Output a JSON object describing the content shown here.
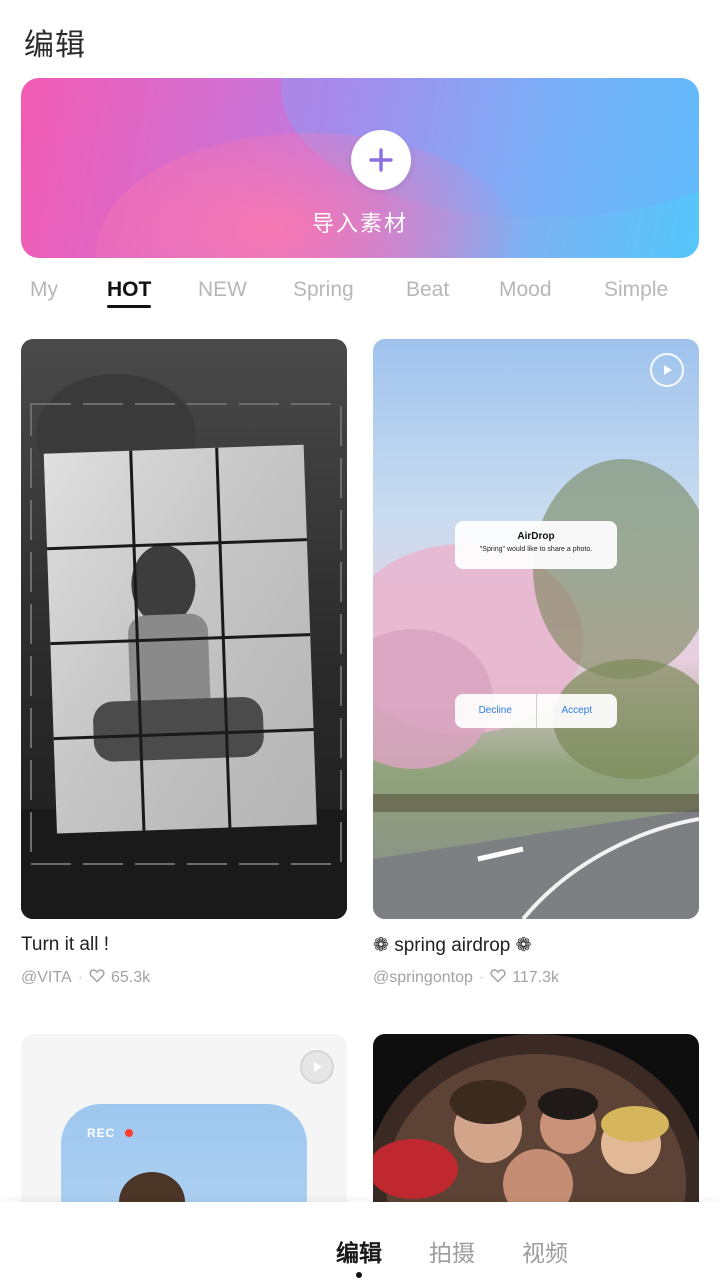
{
  "header": {
    "title": "编辑"
  },
  "banner": {
    "import_label": "导入素材"
  },
  "tabs": [
    "My",
    "HOT",
    "NEW",
    "Spring",
    "Beat",
    "Mood",
    "Simple"
  ],
  "active_tab": "HOT",
  "cards": [
    {
      "title": "Turn it all !",
      "author": "@VITA",
      "likes": "65.3k"
    },
    {
      "title": "❁ spring airdrop ❁",
      "author": "@springontop",
      "likes": "117.3k",
      "dialog": {
        "title": "AirDrop",
        "message": "\"Spring\" would like to share a photo.",
        "decline": "Decline",
        "accept": "Accept"
      }
    },
    {
      "rec_label": "REC"
    },
    {}
  ],
  "bottom_nav": [
    "编辑",
    "拍摄",
    "视频"
  ],
  "colors": {
    "accent_pink": "#f25bb3",
    "accent_blue": "#54c7fb",
    "plus_purple": "#8e6fe0"
  }
}
